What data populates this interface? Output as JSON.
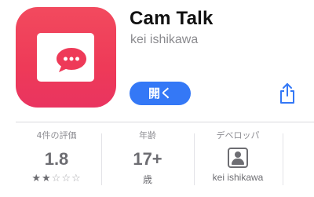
{
  "app": {
    "name": "Cam Talk",
    "developer": "kei ishikawa",
    "icon": "chat-bubble-on-screen-icon",
    "icon_color_top": "#f24a5e",
    "icon_color_bottom": "#e93460"
  },
  "actions": {
    "open_label": "開く",
    "open_color": "#3478f6",
    "share_icon": "share-icon"
  },
  "info": {
    "ratings": {
      "label": "4件の評価",
      "value": "1.8",
      "stars_filled": 2,
      "stars_total": 5
    },
    "age": {
      "label": "年齢",
      "value": "17+",
      "sub": "歳"
    },
    "developer": {
      "label": "デベロッパ",
      "icon": "person-icon",
      "name": "kei ishikawa"
    }
  }
}
